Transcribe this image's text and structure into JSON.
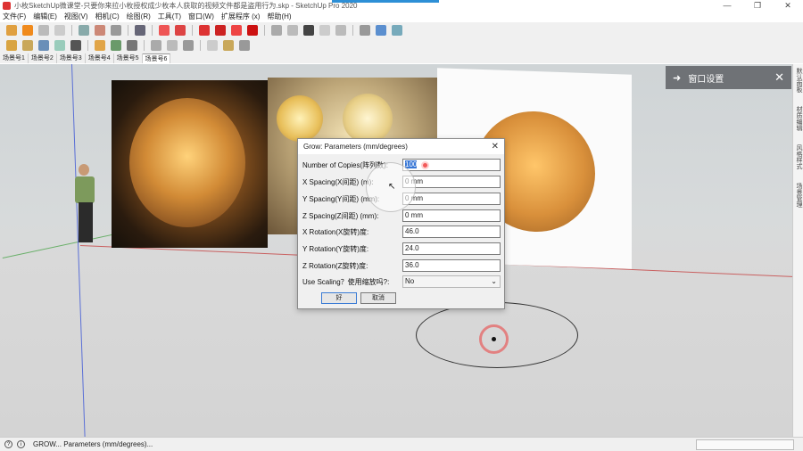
{
  "window": {
    "title": "小枚SketchUp微课堂-只要你来拉小枚授权成少枚本人获取的视频文件都是盗用行为.skp - SketchUp Pro 2020",
    "minimize": "—",
    "maximize": "❐",
    "close": "✕"
  },
  "menu": [
    "文件(F)",
    "编辑(E)",
    "视图(V)",
    "相机(C)",
    "绘图(R)",
    "工具(T)",
    "窗口(W)",
    "扩展程序 (x)",
    "帮助(H)"
  ],
  "scene_tabs": [
    "场景号1",
    "场景号2",
    "场景号3",
    "场景号4",
    "场景号5",
    "场景号6"
  ],
  "active_scene": "场景号6",
  "panel": {
    "arrow": "➜",
    "label": "窗口设置",
    "close": "✕"
  },
  "right_strip": [
    "默认面板",
    "材质编辑",
    "风格样式",
    "场景管理"
  ],
  "dialog": {
    "title": "Grow: Parameters (mm/degrees)",
    "close": "✕",
    "fields": [
      {
        "label": "Number of Copies(阵列数):",
        "value": "100"
      },
      {
        "label": "X Spacing(X间距) (m):",
        "value": "0 mm"
      },
      {
        "label": "Y Spacing(Y间距) (mm):",
        "value": "0 mm"
      },
      {
        "label": "Z Spacing(Z间距) (mm):",
        "value": "0 mm"
      },
      {
        "label": "X Rotation(X旋转)度:",
        "value": "46.0"
      },
      {
        "label": "Y Rotation(Y旋转)度:",
        "value": "24.0"
      },
      {
        "label": "Z Rotation(Z旋转)度:",
        "value": "36.0"
      }
    ],
    "scaling_label": "Use Scaling？使用缩放吗?:",
    "scaling_value": "No",
    "ok_label": "好",
    "cancel_label": "取消"
  },
  "status": {
    "text": "GROW... Parameters (mm/degrees)..."
  },
  "colors": {
    "panel": "#6f7276",
    "selection": "#3877d6",
    "click_ring": "#e75c5c"
  }
}
